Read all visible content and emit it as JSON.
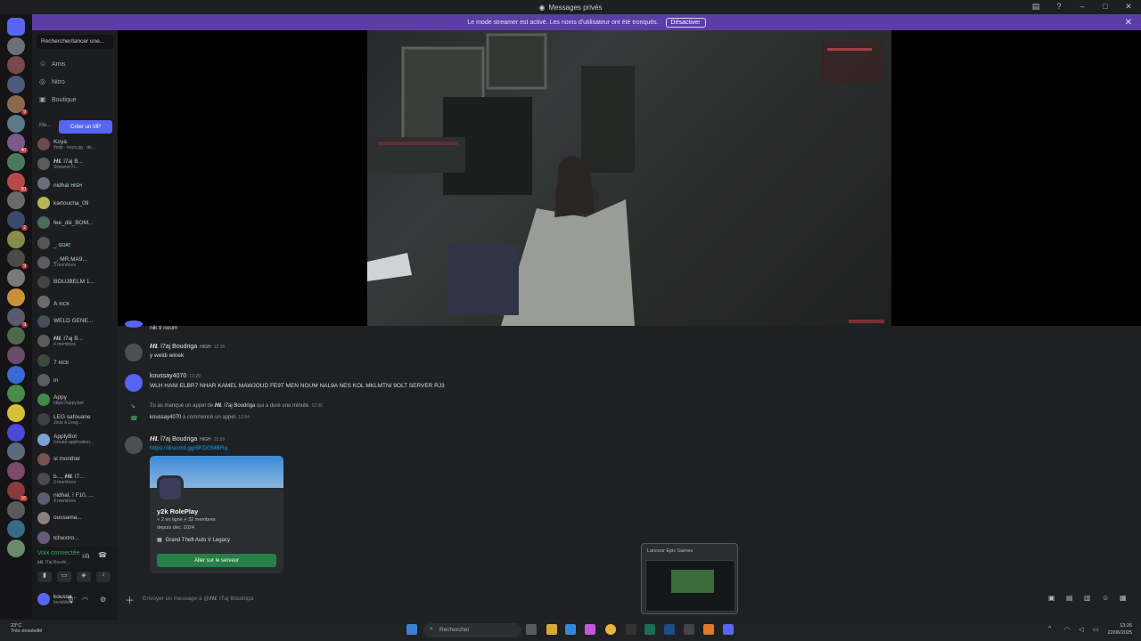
{
  "window": {
    "title": "Messages privés"
  },
  "streamer_banner": {
    "text": "Le mode streamer est activé. Les noms d'utilisateur ont été tronqués.",
    "button": "Désactiver"
  },
  "server_badges": [
    "",
    "",
    "",
    "",
    "9",
    "",
    "40",
    "",
    "60",
    "",
    "2",
    "",
    "9",
    "",
    "",
    "9",
    "",
    "",
    "",
    "",
    "",
    "",
    "",
    "",
    "16",
    "",
    "",
    "",
    "",
    "",
    "14",
    ""
  ],
  "sidebar": {
    "search": "Rechercher/lancer une...",
    "nav": [
      {
        "label": "Amis"
      },
      {
        "label": "Nitro"
      },
      {
        "label": "Boutique"
      }
    ],
    "mp_header": "Me...",
    "create_mp": "Créer un MP",
    "dms": [
      {
        "name": "Koya",
        "sub": "/help · koya.gg · de...",
        "tag": "",
        "color": "#6b4b4b"
      },
      {
        "name": "𝙃𝙇 l7aj B...",
        "sub": "Streame Fi...",
        "tag": "",
        "color": "#5a5a5a"
      },
      {
        "name": "nidhal",
        "sub": "",
        "tag": "HIGH",
        "color": "#6a6f78"
      },
      {
        "name": "kartoucha_09",
        "sub": "",
        "tag": "",
        "color": "#b8b458"
      },
      {
        "name": "fee_diii_BOM...",
        "sub": "",
        "tag": "",
        "color": "#4a6b5a"
      },
      {
        "name": "_",
        "sub": "",
        "tag": "GOAT",
        "color": "#555"
      },
      {
        "name": "_, MR.MA9...",
        "sub": "3 membres",
        "tag": "",
        "color": "#5c5c62"
      },
      {
        "name": "BOUJBELM 1...",
        "sub": "",
        "tag": "",
        "color": "#444"
      },
      {
        "name": "A",
        "sub": "",
        "tag": "KICK",
        "color": "#6a6a6a"
      },
      {
        "name": "WELD GENE...",
        "sub": "",
        "tag": "",
        "color": "#45505a"
      },
      {
        "name": "𝙃𝙇 l7aj B...",
        "sub": "4 membres",
        "tag": "",
        "color": "#5a5a5a"
      },
      {
        "name": "7",
        "sub": "",
        "tag": "KICK",
        "color": "#3f4a3f"
      },
      {
        "name": "m",
        "sub": "",
        "tag": "",
        "color": "#5a5f66"
      },
      {
        "name": "Appy",
        "sub": "https://appy.bot",
        "tag": "",
        "color": "#3d8a4a"
      },
      {
        "name": "LEG safouane",
        "sub": "Joue à Leag...",
        "tag": "",
        "color": "#3c3f45"
      },
      {
        "name": "ApplyBot",
        "sub": "/create-application...",
        "tag": "",
        "color": "#7aa2d6"
      },
      {
        "name": "si monther",
        "sub": "",
        "tag": "",
        "color": "#7a5050"
      },
      {
        "name": "b..., 𝙃𝙇 l7...",
        "sub": "3 membres",
        "tag": "",
        "color": "#4a4a50"
      },
      {
        "name": "nidhal, ! F10, ...",
        "sub": "4 membres",
        "tag": "",
        "color": "#5a6070"
      },
      {
        "name": "oussama...",
        "sub": "",
        "tag": "",
        "color": "#8a7f7a"
      },
      {
        "name": "tchextro...",
        "sub": "",
        "tag": "",
        "color": "#6a5a7a"
      }
    ]
  },
  "voice": {
    "title": "Voix connectée",
    "subtitle": "𝙃𝙇 l7aj Boudri..."
  },
  "user": {
    "name": "koussa...",
    "status": "Invisible"
  },
  "chat": {
    "messages": [
      {
        "type": "continuation",
        "text": "nik ti noum"
      },
      {
        "type": "message",
        "author": "𝙃𝙇 l7aj Boudriga",
        "tag": "HIGH",
        "time": "12:16",
        "text": "y weldi winek"
      },
      {
        "type": "message",
        "author": "koussay4070",
        "tag": "",
        "time": "12:29",
        "text": "WLH HANI ELBR7 NHAR KAMEL MAWJOUD FE9T MEN NOUM NAL9A NES KOL MKLMTNI 9OLT SERVER RJ3"
      },
      {
        "type": "system",
        "prefix": "Tu as manqué un appel de",
        "author": "𝙃𝙇 l7aj Boudriga",
        "suffix": "qui a duré une minute.",
        "time": "12:30"
      },
      {
        "type": "system",
        "author": "koussay4070",
        "suffix": "a commencé un appel.",
        "time": "12:54"
      },
      {
        "type": "message",
        "author": "𝙃𝙇 l7aj Boudriga",
        "tag": "HIGH",
        "time": "12:59",
        "text": "https://discord.gg/6KDGMBRq"
      }
    ],
    "invite": {
      "name": "y2k RolePlay",
      "online": "2 en ligne",
      "members": "32 membres",
      "since": "depuis déc. 2024",
      "game": "Grand Theft Auto V Legacy",
      "button": "Aller sur le serveur"
    }
  },
  "composer": {
    "placeholder": "Envoyer un message à @𝙃𝙇 l7aj Boudriga"
  },
  "preview": {
    "title": "Lanceur Epic Games"
  },
  "taskbar": {
    "weather_temp": "23°C",
    "weather_desc": "Très ensoleillé",
    "search": "Rechercher",
    "time": "13:26",
    "date": "22/06/2025"
  },
  "colors": {
    "accent": "#5865f2",
    "streamer": "#5a3ea6",
    "online": "#3ba55d",
    "join": "#248046"
  }
}
